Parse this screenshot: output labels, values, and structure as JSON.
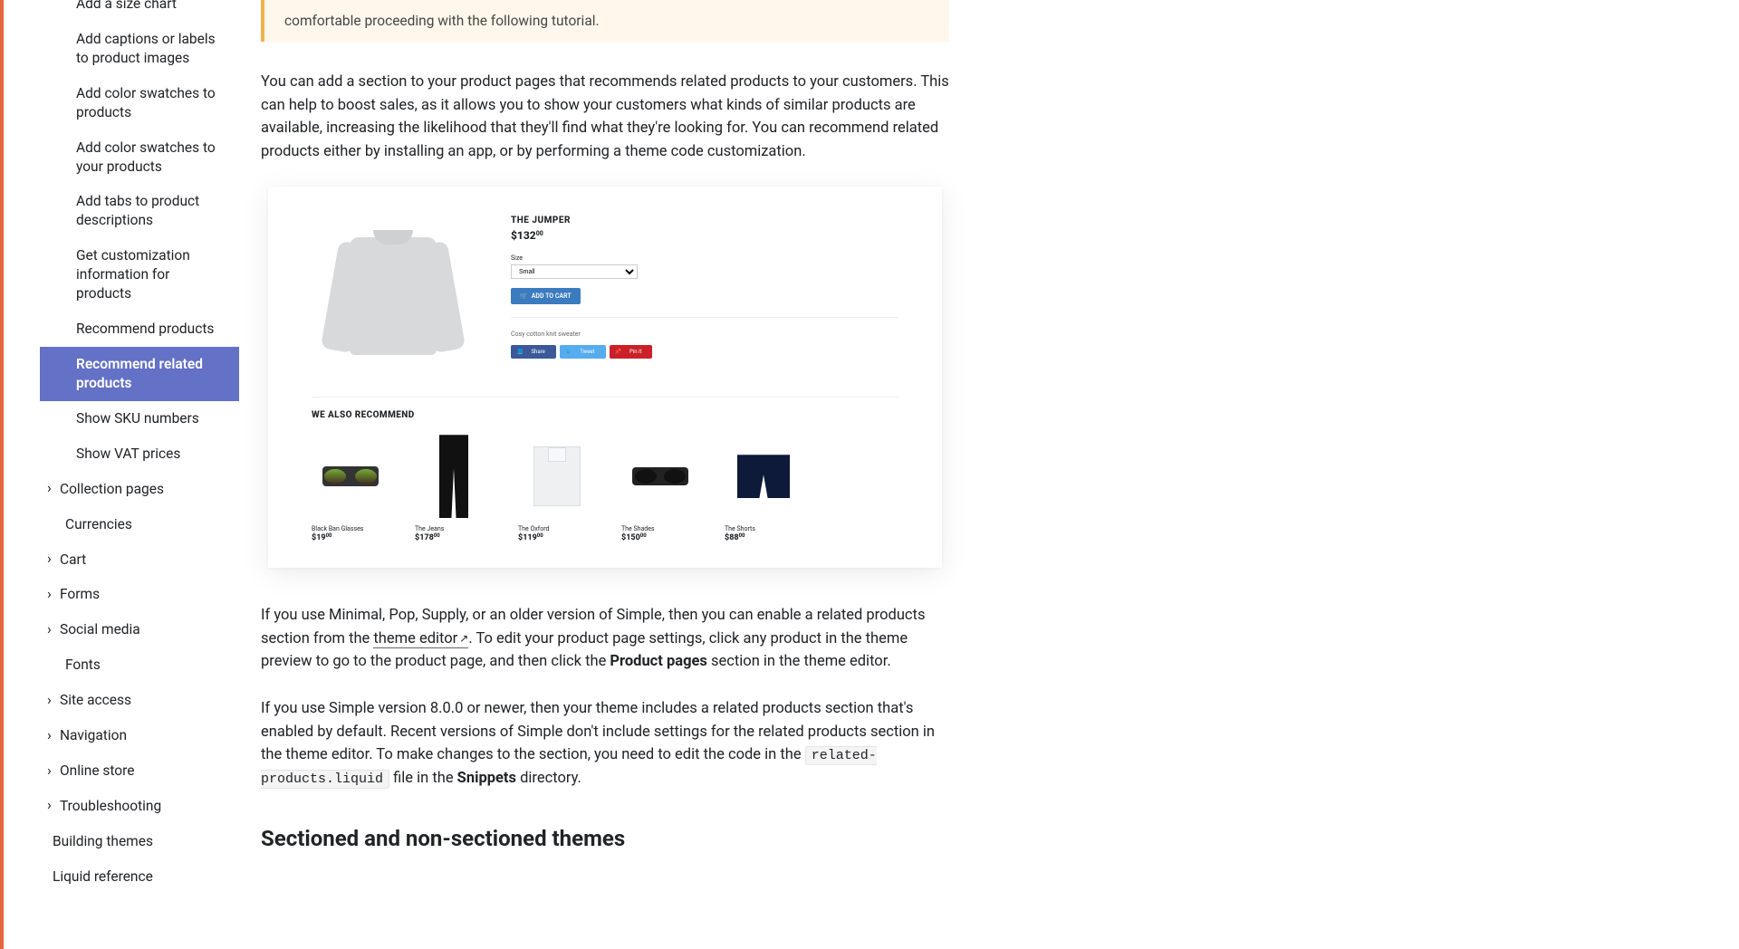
{
  "sidebar": {
    "subitems": [
      "Add a size chart",
      "Add captions or labels to product images",
      "Add color swatches to products",
      "Add color swatches to your products",
      "Add tabs to product descriptions",
      "Get customization information for products",
      "Recommend products",
      "Recommend related products",
      "Show SKU numbers",
      "Show VAT prices"
    ],
    "parents": [
      "Collection pages"
    ],
    "after_parents_items": [
      "Currencies"
    ],
    "parents2": [
      "Cart",
      "Forms",
      "Social media"
    ],
    "after_parents2_items": [
      "Fonts"
    ],
    "parents3": [
      "Site access",
      "Navigation",
      "Online store",
      "Troubleshooting"
    ],
    "bottom": [
      "Building themes",
      "Liquid reference"
    ]
  },
  "note_text": "comfortable proceeding with the following tutorial.",
  "intro_para": "You can add a section to your product pages that recommends related products to your customers. This can help to boost sales, as it allows you to show your customers what kinds of similar products are available, increasing the likelihood that they'll find what they're looking for. You can recommend related products either by installing an app, or by performing a theme code customization.",
  "mock": {
    "product": {
      "title": "THE JUMPER",
      "price": "$132",
      "cents": "00",
      "size_label": "Size",
      "size_value": "Small",
      "add": "ADD TO CART",
      "desc": "Cosy cotton knit sweater",
      "share": "Share",
      "tweet": "Tweet",
      "pin": "Pin it"
    },
    "rec_title": "WE ALSO RECOMMEND",
    "recs": [
      {
        "name": "Black Ban Glasses",
        "price": "$19",
        "cents": "00"
      },
      {
        "name": "The Jeans",
        "price": "$178",
        "cents": "00"
      },
      {
        "name": "The Oxford",
        "price": "$119",
        "cents": "00"
      },
      {
        "name": "The Shades",
        "price": "$150",
        "cents": "00"
      },
      {
        "name": "The Shorts",
        "price": "$88",
        "cents": "00"
      }
    ]
  },
  "para2_a": "If you use Minimal, Pop, Supply, or an older version of Simple, then you can enable a related products section from the ",
  "para2_link": "theme editor",
  "para2_b": ". To edit your product page settings, click any product in the theme preview to go to the product page, and then click the ",
  "para2_strong": "Product pages",
  "para2_c": " section in the theme editor.",
  "para3_a": "If you use Simple version 8.0.0 or newer, then your theme includes a related products section that's enabled by default. Recent versions of Simple don't include settings for the related products section in the theme editor. To make changes to the section, you need to edit the code in the ",
  "para3_code": "related-products.liquid",
  "para3_b": " file in the ",
  "para3_strong": "Snippets",
  "para3_c": " directory.",
  "heading": "Sectioned and non-sectioned themes"
}
